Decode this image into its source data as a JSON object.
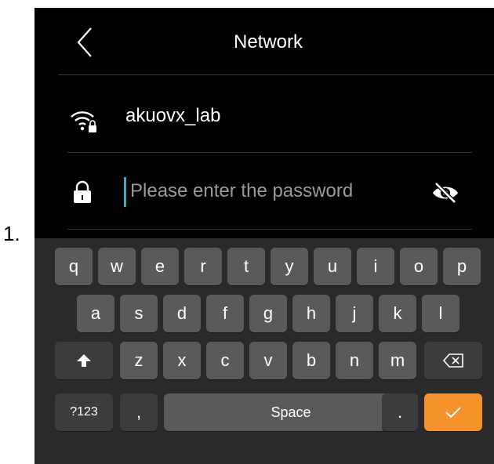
{
  "list_marker": "1.",
  "header": {
    "title": "Network"
  },
  "network": {
    "ssid": "akuovx_lab"
  },
  "password": {
    "placeholder": "Please enter the password",
    "value": ""
  },
  "keyboard": {
    "row1": [
      "q",
      "w",
      "e",
      "r",
      "t",
      "y",
      "u",
      "i",
      "o",
      "p"
    ],
    "row2": [
      "a",
      "s",
      "d",
      "f",
      "g",
      "h",
      "j",
      "k",
      "l"
    ],
    "row3": [
      "z",
      "x",
      "c",
      "v",
      "b",
      "n",
      "m"
    ],
    "symbols_label": "?123",
    "comma_label": ",",
    "space_label": "Space",
    "period_label": "."
  },
  "colors": {
    "background": "#000000",
    "keyboard_bg": "#2a2a2a",
    "key": "#5a5a5a",
    "key_dark": "#3c3c3c",
    "accent_ok": "#f5922b",
    "cursor": "#43a9c0"
  },
  "icons": {
    "back": "chevron-left-icon",
    "wifi": "wifi-lock-icon",
    "lock": "lock-icon",
    "visibility": "eye-off-icon",
    "shift": "shift-arrow-icon",
    "backspace": "backspace-icon",
    "confirm": "checkmark-icon"
  }
}
